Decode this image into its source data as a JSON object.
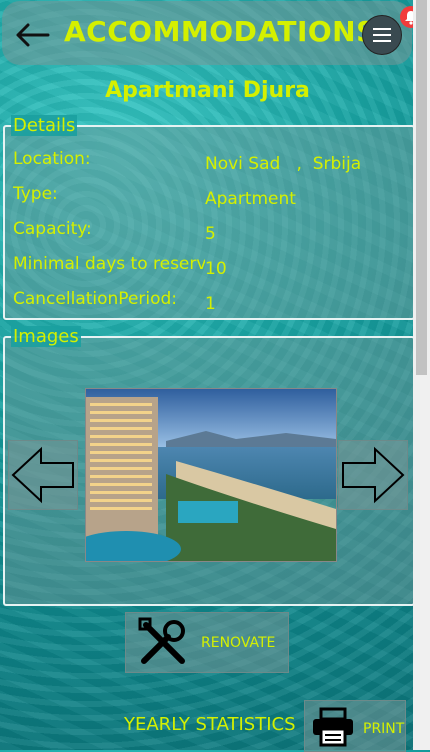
{
  "header": {
    "title": "ACCOMMODATIONS",
    "back_icon": "arrow-left-icon",
    "menu_icon": "hamburger-menu-icon",
    "notification_icon": "bell-icon",
    "notification_color": "#f23b3b"
  },
  "accommodation": {
    "name": "Apartmani Djura"
  },
  "details": {
    "legend": "Details",
    "rows": [
      {
        "label": "Location:",
        "value": "Novi Sad   ,  Srbija"
      },
      {
        "label": "Type:",
        "value": "Apartment"
      },
      {
        "label": "Capacity:",
        "value": "5"
      },
      {
        "label": "Minimal days to reserve:",
        "value": "10"
      },
      {
        "label": "CancellationPeriod:",
        "value": "1"
      }
    ]
  },
  "images": {
    "legend": "Images",
    "prev_icon": "arrow-left-outline-icon",
    "next_icon": "arrow-right-outline-icon"
  },
  "actions": {
    "renovate_label": "RENOVATE",
    "renovate_icon": "tools-icon",
    "yearly_statistics_label": "YEARLY STATISTICS",
    "print_label": "PRINT",
    "print_icon": "printer-icon"
  },
  "colors": {
    "accent_text": "#d4f000",
    "panel_border": "#e6f3f3"
  }
}
